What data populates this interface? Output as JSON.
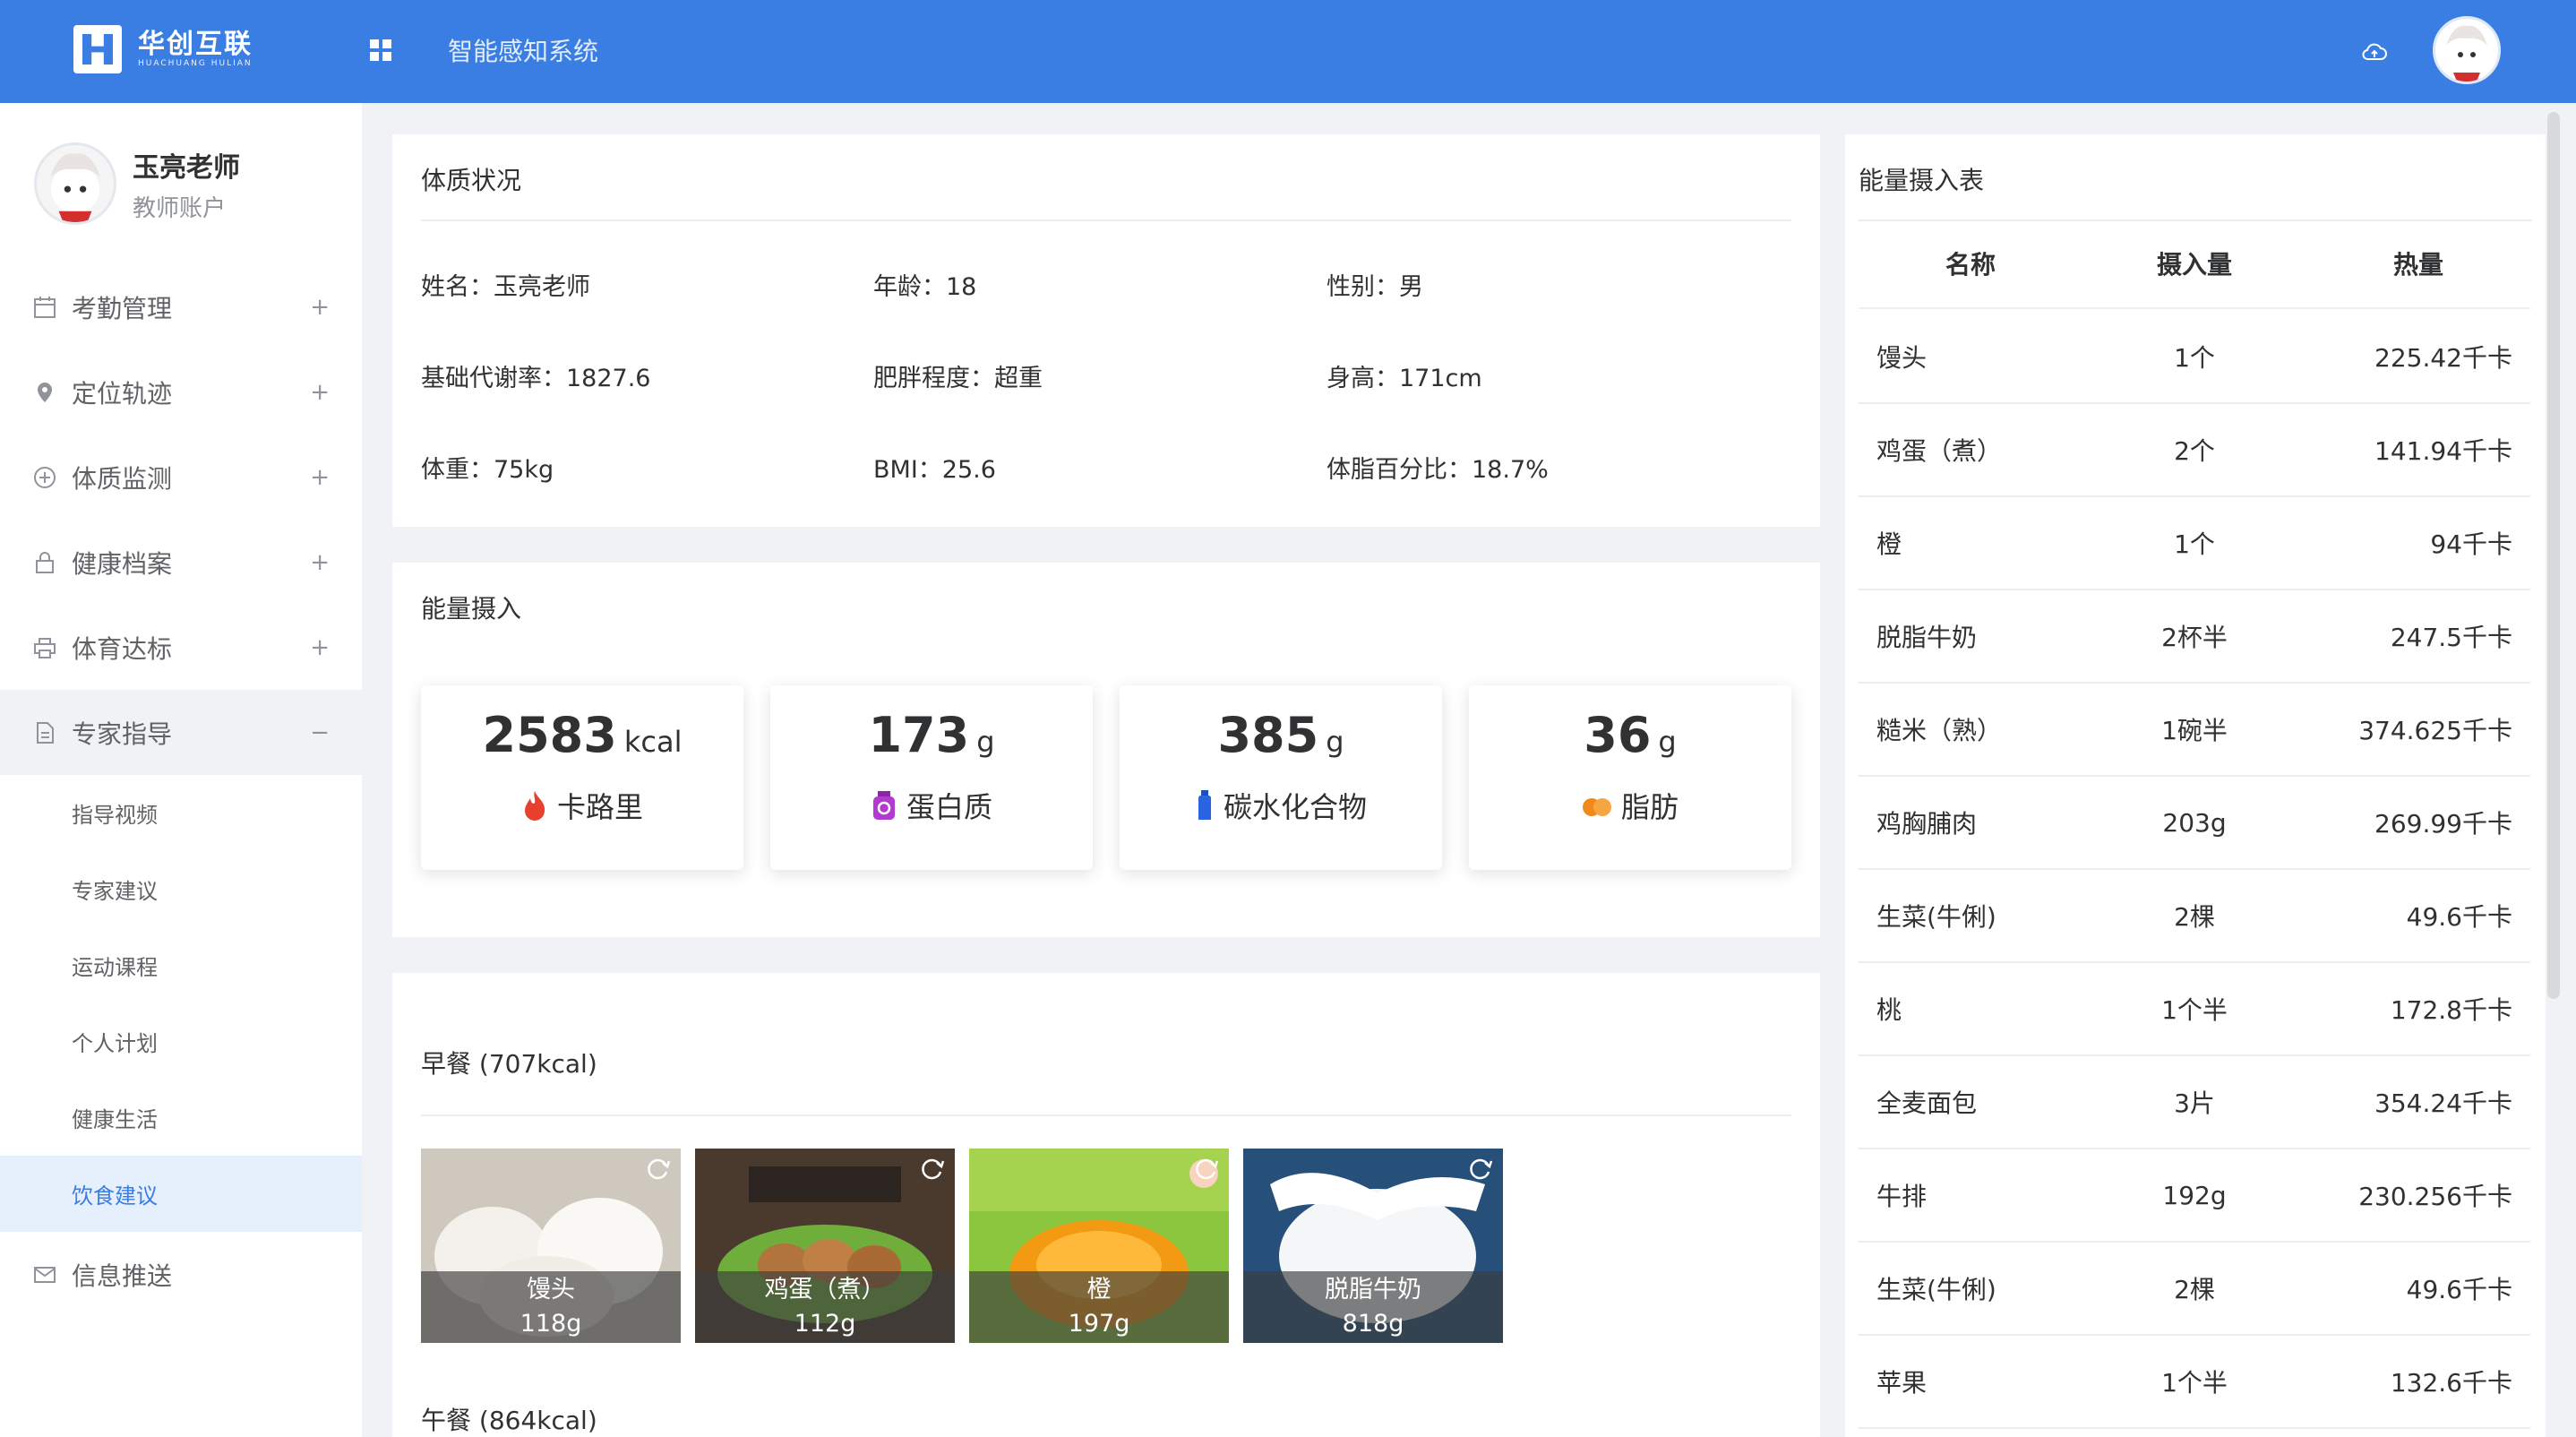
{
  "header": {
    "logo_cn": "华创互联",
    "logo_en": "HUACHUANG HULIAN",
    "system_title": "智能感知系统"
  },
  "user": {
    "name": "玉亮老师",
    "role": "教师账户"
  },
  "menu": [
    {
      "label": "考勤管理",
      "icon": "calendar-icon",
      "toggle": "+"
    },
    {
      "label": "定位轨迹",
      "icon": "location-pin-icon",
      "toggle": "+"
    },
    {
      "label": "体质监测",
      "icon": "plus-circle-icon",
      "toggle": "+"
    },
    {
      "label": "健康档案",
      "icon": "lock-icon",
      "toggle": "+"
    },
    {
      "label": "体育达标",
      "icon": "printer-icon",
      "toggle": "+"
    },
    {
      "label": "专家指导",
      "icon": "document-icon",
      "toggle": "−"
    }
  ],
  "submenu": [
    "指导视频",
    "专家建议",
    "运动课程",
    "个人计划",
    "健康生活",
    "饮食建议"
  ],
  "menu_after": {
    "label": "信息推送",
    "icon": "mail-icon"
  },
  "physique": {
    "title": "体质状况",
    "name": "姓名：玉亮老师",
    "age": "年龄：18",
    "gender": "性别：男",
    "bmr": "基础代谢率：1827.6",
    "obesity": "肥胖程度：超重",
    "height": "身高：171cm",
    "weight": "体重：75kg",
    "bmi": "BMI：25.6",
    "bodyfat": "体脂百分比：18.7%"
  },
  "energy": {
    "title": "能量摄入",
    "stats": [
      {
        "value": "2583",
        "unit": "kcal",
        "label": "卡路里",
        "color": "#e8402e"
      },
      {
        "value": "173",
        "unit": "g",
        "label": "蛋白质",
        "color": "#b23ad1"
      },
      {
        "value": "385",
        "unit": "g",
        "label": "碳水化合物",
        "color": "#2a63e0"
      },
      {
        "value": "36",
        "unit": "g",
        "label": "脂肪",
        "color": "#f08a1c"
      }
    ]
  },
  "meals": {
    "breakfast_title": "早餐 (707kcal)",
    "lunch_title": "午餐 (864kcal)",
    "breakfast_items": [
      {
        "name": "馒头",
        "weight": "118g",
        "bg": "#d9d4cc"
      },
      {
        "name": "鸡蛋（煮）",
        "weight": "112g",
        "bg": "#5b4a3c"
      },
      {
        "name": "橙",
        "weight": "197g",
        "bg": "#f2a11c"
      },
      {
        "name": "脱脂牛奶",
        "weight": "818g",
        "bg": "#2e5a85"
      }
    ]
  },
  "intake_table": {
    "title": "能量摄入表",
    "headers": [
      "名称",
      "摄入量",
      "热量"
    ],
    "rows": [
      [
        "馒头",
        "1个",
        "225.42千卡"
      ],
      [
        "鸡蛋（煮）",
        "2个",
        "141.94千卡"
      ],
      [
        "橙",
        "1个",
        "94千卡"
      ],
      [
        "脱脂牛奶",
        "2杯半",
        "247.5千卡"
      ],
      [
        "糙米（熟）",
        "1碗半",
        "374.625千卡"
      ],
      [
        "鸡胸脯肉",
        "203g",
        "269.99千卡"
      ],
      [
        "生菜(牛俐)",
        "2棵",
        "49.6千卡"
      ],
      [
        "桃",
        "1个半",
        "172.8千卡"
      ],
      [
        "全麦面包",
        "3片",
        "354.24千卡"
      ],
      [
        "牛排",
        "192g",
        "230.256千卡"
      ],
      [
        "生菜(牛俐)",
        "2棵",
        "49.6千卡"
      ],
      [
        "苹果",
        "1个半",
        "132.6千卡"
      ]
    ]
  }
}
